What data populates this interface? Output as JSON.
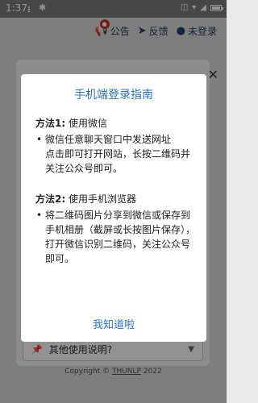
{
  "status_bar": {
    "time": "1:37"
  },
  "topnav": {
    "notice_label": "公告",
    "notice_badge": "●",
    "feedback_label": "反馈",
    "login_label": "未登录"
  },
  "faq": {
    "label": "其他使用说明?"
  },
  "footer": {
    "prefix": "Copyright ©",
    "org": "THUNLP",
    "year": "2022"
  },
  "modal": {
    "title": "手机端登录指南",
    "method1": {
      "heading_bold": "方法1:",
      "heading_text": " 使用微信",
      "item_line1": "微信任意聊天窗口中发送网址",
      "item_line2": "点击即可打开网站，长按二维码并关注公众号即可。"
    },
    "method2": {
      "heading_bold": "方法2:",
      "heading_text": " 使用手机浏览器",
      "item": "将二维码图片分享到微信或保存到手机相册（截屏或长按图片保存），打开微信识别二维码，关注公众号即可。"
    },
    "ok_label": "我知道啦"
  },
  "colors": {
    "accent": "#2a73c9",
    "badge": "#c0392b"
  }
}
